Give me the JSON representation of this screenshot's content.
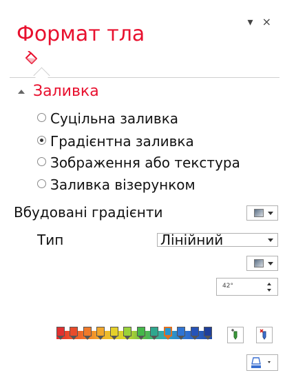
{
  "pane": {
    "title": "Формат тла",
    "controls": "▾ ×",
    "icon": "paint-bucket-icon"
  },
  "fill_section": {
    "label": "Заливка",
    "options": [
      {
        "label": "Суцільна заливка",
        "selected": false
      },
      {
        "label": "Градієнтна заливка",
        "selected": true
      },
      {
        "label": "Зображення або текстура",
        "selected": false
      },
      {
        "label": "Заливка візерунком",
        "selected": false
      }
    ]
  },
  "gradient": {
    "preset_label": "Вбудовані градієнти",
    "type_label": "Тип",
    "type_value": "Лінійний",
    "angle_value": "42°",
    "stop_colors": [
      "#e23030",
      "#e94b2b",
      "#ef7a2b",
      "#f1a72b",
      "#e5d02a",
      "#9ad23a",
      "#45b84a",
      "#2fa78e",
      "#2a95cf",
      "#2f74d4",
      "#2653b8",
      "#1f3f9a"
    ],
    "selected_stop_index": 8
  },
  "colors": {
    "accent": "#e8102e"
  }
}
